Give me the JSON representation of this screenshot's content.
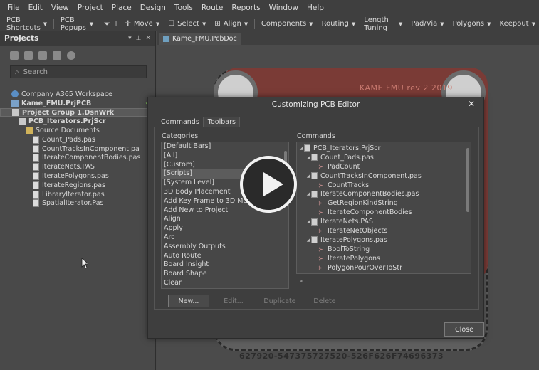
{
  "menu": [
    "File",
    "Edit",
    "View",
    "Project",
    "Place",
    "Design",
    "Tools",
    "Route",
    "Reports",
    "Window",
    "Help"
  ],
  "toolbar": {
    "pcb_shortcuts": "PCB Shortcuts",
    "pcb_popups": "PCB Popups",
    "move": "Move",
    "select": "Select",
    "align": "Align",
    "components": "Components",
    "routing": "Routing",
    "length_tuning": "Length Tuning",
    "pad_via": "Pad/Via",
    "polygons": "Polygons",
    "keepout": "Keepout"
  },
  "projects_panel": {
    "title": "Projects",
    "search_placeholder": "Search",
    "tree": [
      {
        "label": "Company A365 Workspace",
        "icon": "workspace-icon"
      },
      {
        "label": "Kame_FMU.PrjPCB",
        "icon": "pcb-project-icon"
      },
      {
        "label": "Project Group 1.DsnWrk",
        "icon": "project-group-icon"
      },
      {
        "label": "PCB_Iterators.PrjScr",
        "icon": "script-project-icon"
      },
      {
        "label": "Source Documents",
        "icon": "folder-icon"
      },
      {
        "label": "Count_Pads.pas"
      },
      {
        "label": "CountTracksInComponent.pa"
      },
      {
        "label": "IterateComponentBodies.pas"
      },
      {
        "label": "IterateNets.PAS"
      },
      {
        "label": "IteratePolygons.pas"
      },
      {
        "label": "IterateRegions.pas"
      },
      {
        "label": "LibraryIterator.pas"
      },
      {
        "label": "SpatialIterator.Pas"
      }
    ]
  },
  "doc_tab": "Kame_FMU.PcbDoc",
  "board": {
    "title": "KAME FMU rev 2 2019",
    "coords": "627920-547375727520-526F626F74696373"
  },
  "dialog": {
    "title": "Customizing PCB Editor",
    "tabs": [
      "Commands",
      "Toolbars"
    ],
    "categories_label": "Categories",
    "commands_label": "Commands",
    "categories": [
      "[Default Bars]",
      "[All]",
      "[Custom]",
      "[Scripts]",
      "[System Level]",
      "3D Body Placement",
      "Add Key Frame to 3D Movie",
      "Add New to Project",
      "Align",
      "Apply",
      "Arc",
      "Assembly Outputs",
      "Auto Route",
      "Board Insight",
      "Board Shape",
      "Clear"
    ],
    "selected_category": "[Scripts]",
    "commands_tree": [
      {
        "label": "PCB_Iterators.PrjScr",
        "level": 0,
        "kind": "project"
      },
      {
        "label": "Count_Pads.pas",
        "level": 1,
        "kind": "file"
      },
      {
        "label": "PadCount",
        "level": 2,
        "kind": "proc"
      },
      {
        "label": "CountTracksInComponent.pas",
        "level": 1,
        "kind": "file"
      },
      {
        "label": "CountTracks",
        "level": 2,
        "kind": "proc"
      },
      {
        "label": "IterateComponentBodies.pas",
        "level": 1,
        "kind": "file"
      },
      {
        "label": "GetRegionKindString",
        "level": 2,
        "kind": "proc"
      },
      {
        "label": "IterateComponentBodies",
        "level": 2,
        "kind": "proc"
      },
      {
        "label": "IterateNets.PAS",
        "level": 1,
        "kind": "file"
      },
      {
        "label": "IterateNetObjects",
        "level": 2,
        "kind": "proc"
      },
      {
        "label": "IteratePolygons.pas",
        "level": 1,
        "kind": "file"
      },
      {
        "label": "BoolToString",
        "level": 2,
        "kind": "proc"
      },
      {
        "label": "IteratePolygons",
        "level": 2,
        "kind": "proc"
      },
      {
        "label": "PolygonPourOverToStr",
        "level": 2,
        "kind": "proc"
      }
    ],
    "buttons": {
      "new": "New...",
      "edit": "Edit...",
      "duplicate": "Duplicate",
      "delete": "Delete",
      "close": "Close"
    }
  },
  "colors": {
    "accent": "#5a8ec4",
    "board_red": "#7a3b36",
    "selection": "#5c5c5c"
  }
}
